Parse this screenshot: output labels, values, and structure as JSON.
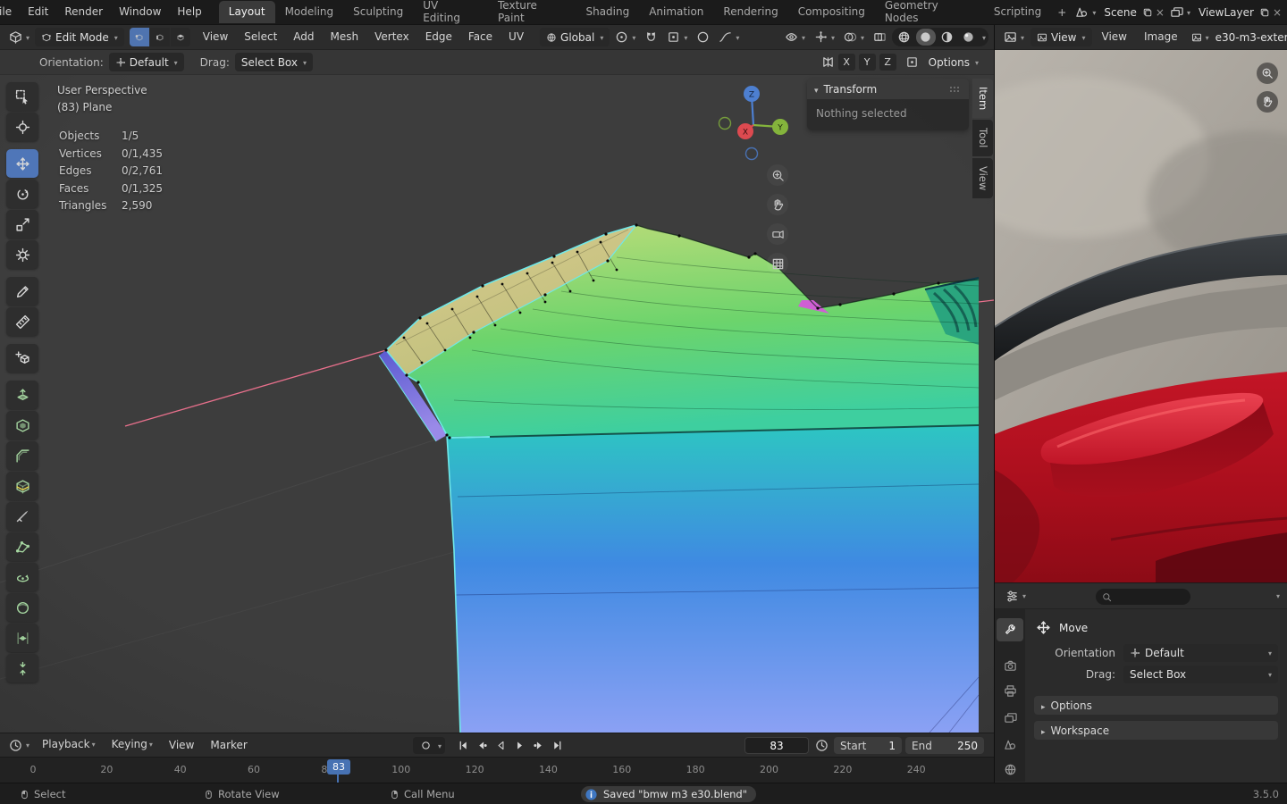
{
  "topbar": {
    "menus": [
      {
        "label": "File"
      },
      {
        "label": "Edit"
      },
      {
        "label": "Render"
      },
      {
        "label": "Window"
      },
      {
        "label": "Help"
      }
    ],
    "workspaces": [
      {
        "label": "Layout"
      },
      {
        "label": "Modeling"
      },
      {
        "label": "Sculpting"
      },
      {
        "label": "UV Editing"
      },
      {
        "label": "Texture Paint"
      },
      {
        "label": "Shading"
      },
      {
        "label": "Animation"
      },
      {
        "label": "Rendering"
      },
      {
        "label": "Compositing"
      },
      {
        "label": "Geometry Nodes"
      },
      {
        "label": "Scripting"
      }
    ],
    "active_workspace": "Layout",
    "add_workspace_label": "+",
    "scene_label": "Scene",
    "view_layer_label": "ViewLayer"
  },
  "viewport_header": {
    "mode": "Edit Mode",
    "menus": [
      {
        "label": "View"
      },
      {
        "label": "Select"
      },
      {
        "label": "Add"
      },
      {
        "label": "Mesh"
      },
      {
        "label": "Vertex"
      },
      {
        "label": "Edge"
      },
      {
        "label": "Face"
      },
      {
        "label": "UV"
      }
    ],
    "orientation": "Global"
  },
  "tool_settings": {
    "orientation_label": "Orientation:",
    "orientation_value": "Default",
    "drag_label": "Drag:",
    "drag_value": "Select Box",
    "axes": [
      {
        "label": "X"
      },
      {
        "label": "Y"
      },
      {
        "label": "Z"
      }
    ],
    "options_label": "Options"
  },
  "toolbar": {
    "tools": [
      {
        "id": "select-box",
        "icon": "tweak"
      },
      {
        "id": "cursor",
        "icon": "cursor3d"
      },
      {
        "id": "move",
        "icon": "move",
        "active": true
      },
      {
        "id": "rotate",
        "icon": "rotate"
      },
      {
        "id": "scale",
        "icon": "scale"
      },
      {
        "id": "transform",
        "icon": "transform"
      },
      {
        "id": "annotate",
        "icon": "annotate"
      },
      {
        "id": "measure",
        "icon": "measure"
      },
      {
        "id": "add-cube",
        "icon": "addcube"
      },
      {
        "id": "extrude-region",
        "icon": "extrude",
        "tint": "g"
      },
      {
        "id": "inset-faces",
        "icon": "inset",
        "tint": "g"
      },
      {
        "id": "bevel",
        "icon": "bevel",
        "tint": "g"
      },
      {
        "id": "loop-cut",
        "icon": "loopcut",
        "tint": "g"
      },
      {
        "id": "knife",
        "icon": "knife"
      },
      {
        "id": "poly-build",
        "icon": "polybuild",
        "tint": "g"
      },
      {
        "id": "spin",
        "icon": "spin",
        "tint": "g"
      },
      {
        "id": "smooth",
        "icon": "smooth",
        "tint": "g"
      },
      {
        "id": "edge-slide",
        "icon": "slide",
        "tint": "g"
      },
      {
        "id": "shrink-fatten",
        "icon": "shrink",
        "tint": "g"
      }
    ]
  },
  "viewport": {
    "perspective_label": "User Perspective",
    "object_label": "(83) Plane",
    "stats": [
      {
        "label": "Objects",
        "value": "1/5"
      },
      {
        "label": "Vertices",
        "value": "0/1,435"
      },
      {
        "label": "Edges",
        "value": "0/2,761"
      },
      {
        "label": "Faces",
        "value": "0/1,325"
      },
      {
        "label": "Triangles",
        "value": "2,590"
      }
    ],
    "gizmo": {
      "x": "X",
      "y": "Y",
      "z": "Z"
    }
  },
  "transform_panel": {
    "title": "Transform",
    "message": "Nothing selected",
    "tabs": [
      {
        "label": "Item"
      },
      {
        "label": "Tool"
      },
      {
        "label": "View"
      }
    ],
    "active_tab": "Item"
  },
  "image_editor": {
    "mode": "View",
    "menus": [
      {
        "label": "View"
      },
      {
        "label": "Image"
      }
    ],
    "image_name": "e30-m3-exter"
  },
  "properties": {
    "tool_name": "Move",
    "orientation_label": "Orientation",
    "orientation_value": "Default",
    "drag_label": "Drag:",
    "drag_value": "Select Box",
    "sections": [
      {
        "label": "Options"
      },
      {
        "label": "Workspace"
      }
    ]
  },
  "timeline": {
    "playback_label": "Playback",
    "keying_label": "Keying",
    "menus": [
      {
        "label": "View"
      },
      {
        "label": "Marker"
      }
    ],
    "current_frame": "83",
    "start_label": "Start",
    "start_value": "1",
    "end_label": "End",
    "end_value": "250",
    "ruler": [
      "0",
      "20",
      "40",
      "60",
      "80",
      "100",
      "120",
      "140",
      "160",
      "180",
      "200",
      "220",
      "240"
    ]
  },
  "status_bar": {
    "hints": [
      {
        "label": "Select"
      },
      {
        "label": "Rotate View"
      },
      {
        "label": "Call Menu"
      }
    ],
    "message": "Saved \"bmw m3 e30.blend\"",
    "version": "3.5.0"
  },
  "colors": {
    "accent": "#4772b3",
    "axis_x": "#dd4a50",
    "axis_y": "#84b43c",
    "axis_z": "#4d7fd0",
    "selection_edge": "#70e8e8"
  }
}
